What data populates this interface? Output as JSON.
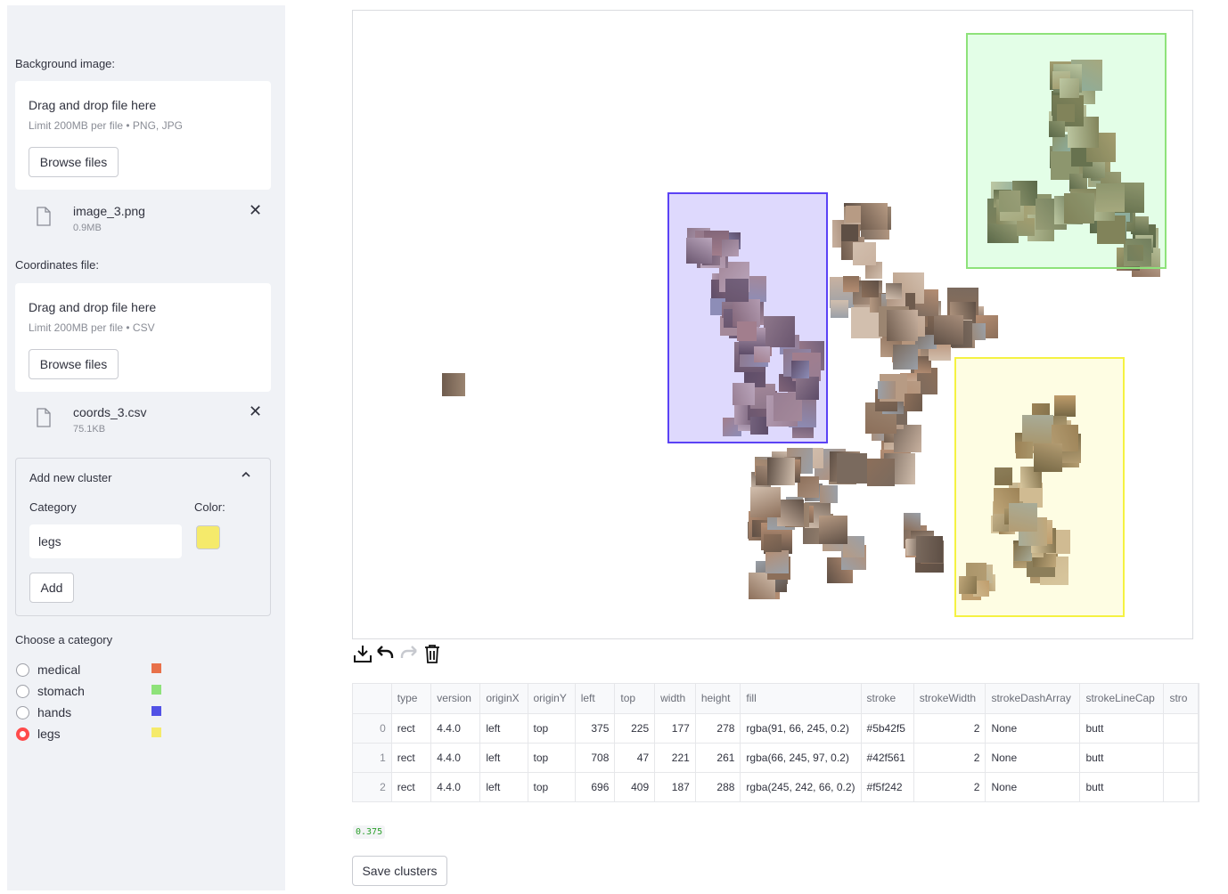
{
  "sidebar": {
    "background_label": "Background image:",
    "background_uploader": {
      "title": "Drag and drop file here",
      "limit": "Limit 200MB per file • PNG, JPG",
      "button": "Browse files",
      "file": {
        "name": "image_3.png",
        "size": "0.9MB",
        "close": "✕"
      }
    },
    "coords_label": "Coordinates file:",
    "coords_uploader": {
      "title": "Drag and drop file here",
      "limit": "Limit 200MB per file • CSV",
      "button": "Browse files",
      "file": {
        "name": "coords_3.csv",
        "size": "75.1KB",
        "close": "✕"
      }
    },
    "add_cluster": {
      "title": "Add new cluster",
      "category_label": "Category",
      "color_label": "Color:",
      "category_value": "legs",
      "color_value": "#f5ea6b",
      "add_button": "Add"
    },
    "choose_label": "Choose a category",
    "categories": [
      {
        "label": "medical",
        "color": "#e8714a",
        "selected": false
      },
      {
        "label": "stomach",
        "color": "#8ee27a",
        "selected": false
      },
      {
        "label": "hands",
        "color": "#5252e6",
        "selected": false
      },
      {
        "label": "legs",
        "color": "#f5ea6b",
        "selected": true
      }
    ]
  },
  "toolbar": {
    "download": "download-icon",
    "undo": "undo-icon",
    "redo": "redo-icon",
    "delete": "trash-icon"
  },
  "table": {
    "columns": [
      "",
      "type",
      "version",
      "originX",
      "originY",
      "left",
      "top",
      "width",
      "height",
      "fill",
      "stroke",
      "strokeWidth",
      "strokeDashArray",
      "strokeLineCap",
      "stro"
    ],
    "rows": [
      [
        "0",
        "rect",
        "4.4.0",
        "left",
        "top",
        "375",
        "225",
        "177",
        "278",
        "rgba(91, 66, 245, 0.2)",
        "#5b42f5",
        "2",
        "None",
        "butt",
        ""
      ],
      [
        "1",
        "rect",
        "4.4.0",
        "left",
        "top",
        "708",
        "47",
        "221",
        "261",
        "rgba(66, 245, 97, 0.2)",
        "#42f561",
        "2",
        "None",
        "butt",
        ""
      ],
      [
        "2",
        "rect",
        "4.4.0",
        "left",
        "top",
        "696",
        "409",
        "187",
        "288",
        "rgba(245, 242, 66, 0.2)",
        "#f5f242",
        "2",
        "None",
        "butt",
        ""
      ]
    ]
  },
  "output_value": "0.375",
  "save_button": "Save clusters"
}
